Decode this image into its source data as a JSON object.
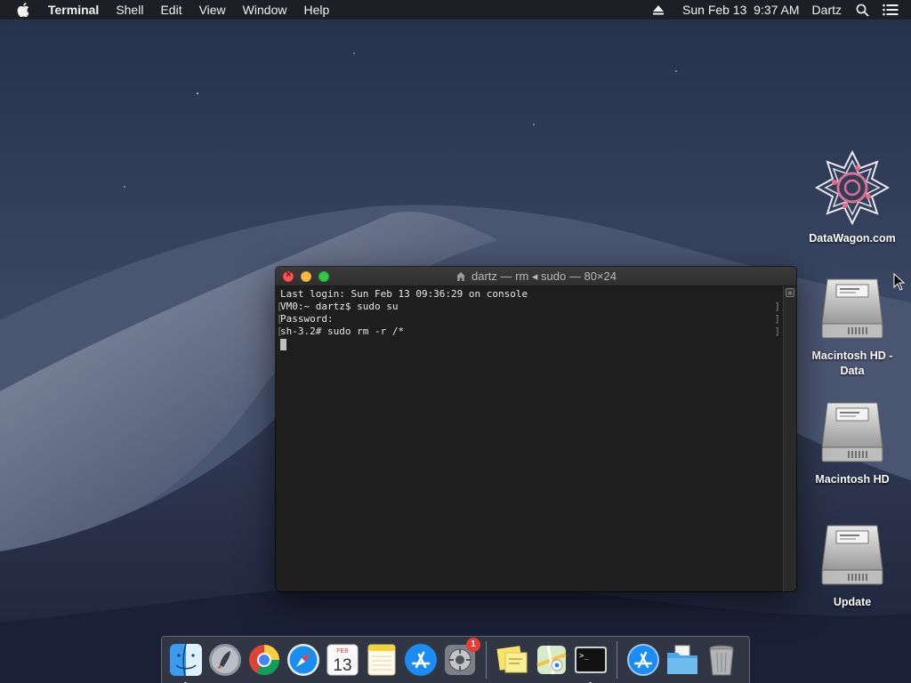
{
  "menubar": {
    "app_name": "Terminal",
    "items": [
      "Shell",
      "Edit",
      "View",
      "Window",
      "Help"
    ],
    "datetime": "Sun Feb 13  9:37 AM",
    "user": "Dartz",
    "icons": [
      "apple-icon",
      "eject-icon",
      "spotlight-search-icon",
      "notification-center-icon"
    ]
  },
  "desktop_icons": [
    {
      "label": "DataWagon.com",
      "icon": "datawagon-logo-icon"
    },
    {
      "label": "Macintosh HD -\nData",
      "icon": "hard-drive-icon"
    },
    {
      "label": "Macintosh HD",
      "icon": "hard-drive-icon"
    },
    {
      "label": "Update",
      "icon": "hard-drive-icon"
    }
  ],
  "terminal": {
    "title": "dartz — rm ◂ sudo — 80×24",
    "lines": [
      "Last login: Sun Feb 13 09:36:29 on console",
      "VM0:~ dartz$ sudo su",
      "Password:",
      "sh-3.2# sudo rm -r /*"
    ]
  },
  "dock": {
    "items": [
      {
        "name": "Finder",
        "icon": "finder-icon",
        "running": true
      },
      {
        "name": "Launchpad",
        "icon": "launchpad-icon",
        "running": false
      },
      {
        "name": "Google Chrome",
        "icon": "chrome-icon",
        "running": false
      },
      {
        "name": "Safari",
        "icon": "safari-icon",
        "running": false
      },
      {
        "name": "Calendar",
        "icon": "calendar-icon",
        "running": false,
        "month": "FEB",
        "day": "13"
      },
      {
        "name": "Notes",
        "icon": "notes-icon",
        "running": false
      },
      {
        "name": "App Store",
        "icon": "app-store-icon",
        "running": false
      },
      {
        "name": "System Preferences",
        "icon": "system-preferences-icon",
        "running": false,
        "badge": "1"
      },
      {
        "name": "Stickies",
        "icon": "stickies-icon",
        "running": false
      },
      {
        "name": "Maps",
        "icon": "maps-icon",
        "running": false
      },
      {
        "name": "Terminal",
        "icon": "terminal-icon",
        "running": true
      },
      {
        "name": "Applications",
        "icon": "applications-folder-icon",
        "running": false
      },
      {
        "name": "Documents",
        "icon": "documents-folder-icon",
        "running": false
      },
      {
        "name": "Trash",
        "icon": "trash-icon",
        "running": false
      }
    ]
  },
  "colors": {
    "menubar_bg": "#1c1c20",
    "terminal_bg": "#1e1e1e",
    "close": "#fc5753",
    "minimize": "#fdbc40",
    "maximize": "#33c748",
    "badge": "#ec3b30"
  }
}
